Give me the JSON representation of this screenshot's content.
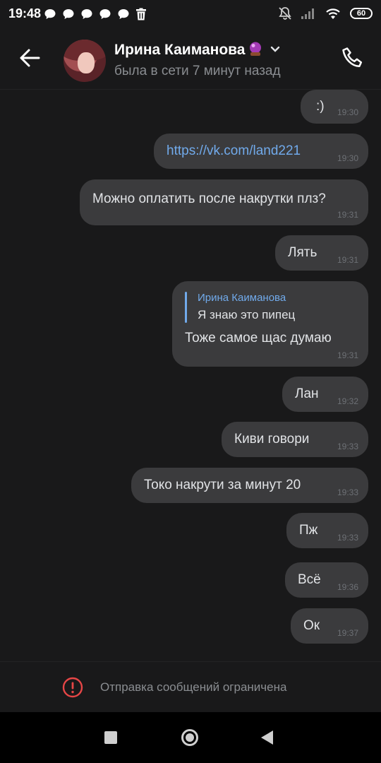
{
  "status_bar": {
    "time": "19:48",
    "battery": "60",
    "notification_icons": [
      "chat-bubble-icon",
      "chat-bubble-icon",
      "chat-bubble-icon",
      "chat-bubble-icon",
      "chat-bubble-icon",
      "trash-icon"
    ],
    "right_icons": [
      "dnd-bell-icon",
      "cell-signal-icon",
      "wifi-icon",
      "battery-icon"
    ]
  },
  "header": {
    "name": "Ирина Каиманова",
    "status": "была в сети 7 минут назад",
    "name_badge_icon": "crystal-ball-icon",
    "icons": [
      "back-arrow-icon",
      "chevron-down-icon",
      "phone-icon"
    ]
  },
  "messages": [
    {
      "text": ":)",
      "time": "19:30"
    },
    {
      "text": "https://vk.com/land221",
      "time": "19:30",
      "is_link": true
    },
    {
      "text": "Можно оплатить после накрутки плз?",
      "time": "19:31"
    },
    {
      "text": "Лять",
      "time": "19:31"
    },
    {
      "reply_name": "Ирина Каиманова",
      "reply_text": "Я знаю это пипец",
      "text": "Тоже самое щас думаю",
      "time": "19:31"
    },
    {
      "text": "Лан",
      "time": "19:32"
    },
    {
      "text": "Киви говори",
      "time": "19:33"
    },
    {
      "text": "Токо накрути за минут 20",
      "time": "19:33"
    },
    {
      "text": "Пж",
      "time": "19:33"
    },
    {
      "text": "Всё",
      "time": "19:36"
    },
    {
      "text": "Ок",
      "time": "19:37"
    }
  ],
  "restriction": {
    "text": "Отправка сообщений ограничена",
    "icon": "alert-circle-icon"
  },
  "nav": {
    "icons": [
      "recents-square-icon",
      "home-circle-icon",
      "back-triangle-icon"
    ]
  },
  "colors": {
    "background": "#19191a",
    "bubble": "#3b3b3d",
    "link": "#71aaeb",
    "alert": "#e64646"
  }
}
